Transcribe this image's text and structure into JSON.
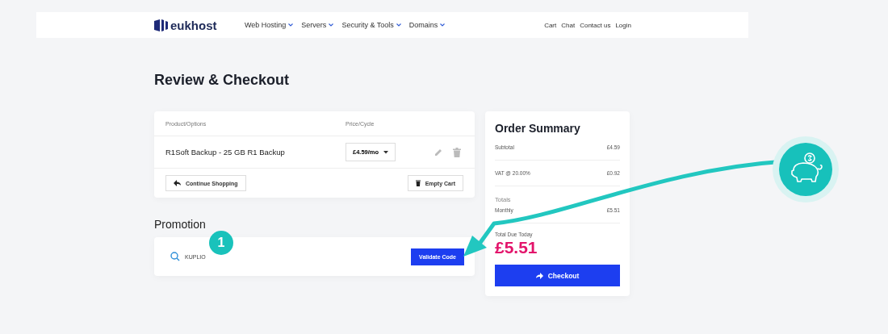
{
  "header": {
    "logo": "eukhost",
    "nav": [
      {
        "label": "Web Hosting"
      },
      {
        "label": "Servers"
      },
      {
        "label": "Security & Tools"
      },
      {
        "label": "Domains"
      }
    ],
    "links": [
      "Cart",
      "Chat",
      "Contact us",
      "Login"
    ]
  },
  "page_title": "Review & Checkout",
  "cart": {
    "columns": [
      "Product/Options",
      "Price/Cycle"
    ],
    "items": [
      {
        "name": "R1Soft Backup - 25 GB R1 Backup",
        "price": "£4.59/mo"
      }
    ],
    "continue_button": "Continue Shopping",
    "empty_button": "Empty Cart"
  },
  "promotion": {
    "heading": "Promotion",
    "code": "KUPLIO",
    "button": "Validate Code",
    "step": "1"
  },
  "summary": {
    "title": "Order Summary",
    "lines": [
      {
        "label": "Subtotal",
        "value": "£4.59"
      },
      {
        "label": "VAT @ 20.00%",
        "value": "£0.92"
      }
    ],
    "totals_label": "Totals",
    "total_line": {
      "label": "Monthly",
      "value": "£5.51"
    },
    "due_label": "Total Due Today",
    "due_amount": "£5.51",
    "checkout_button": "Checkout"
  }
}
